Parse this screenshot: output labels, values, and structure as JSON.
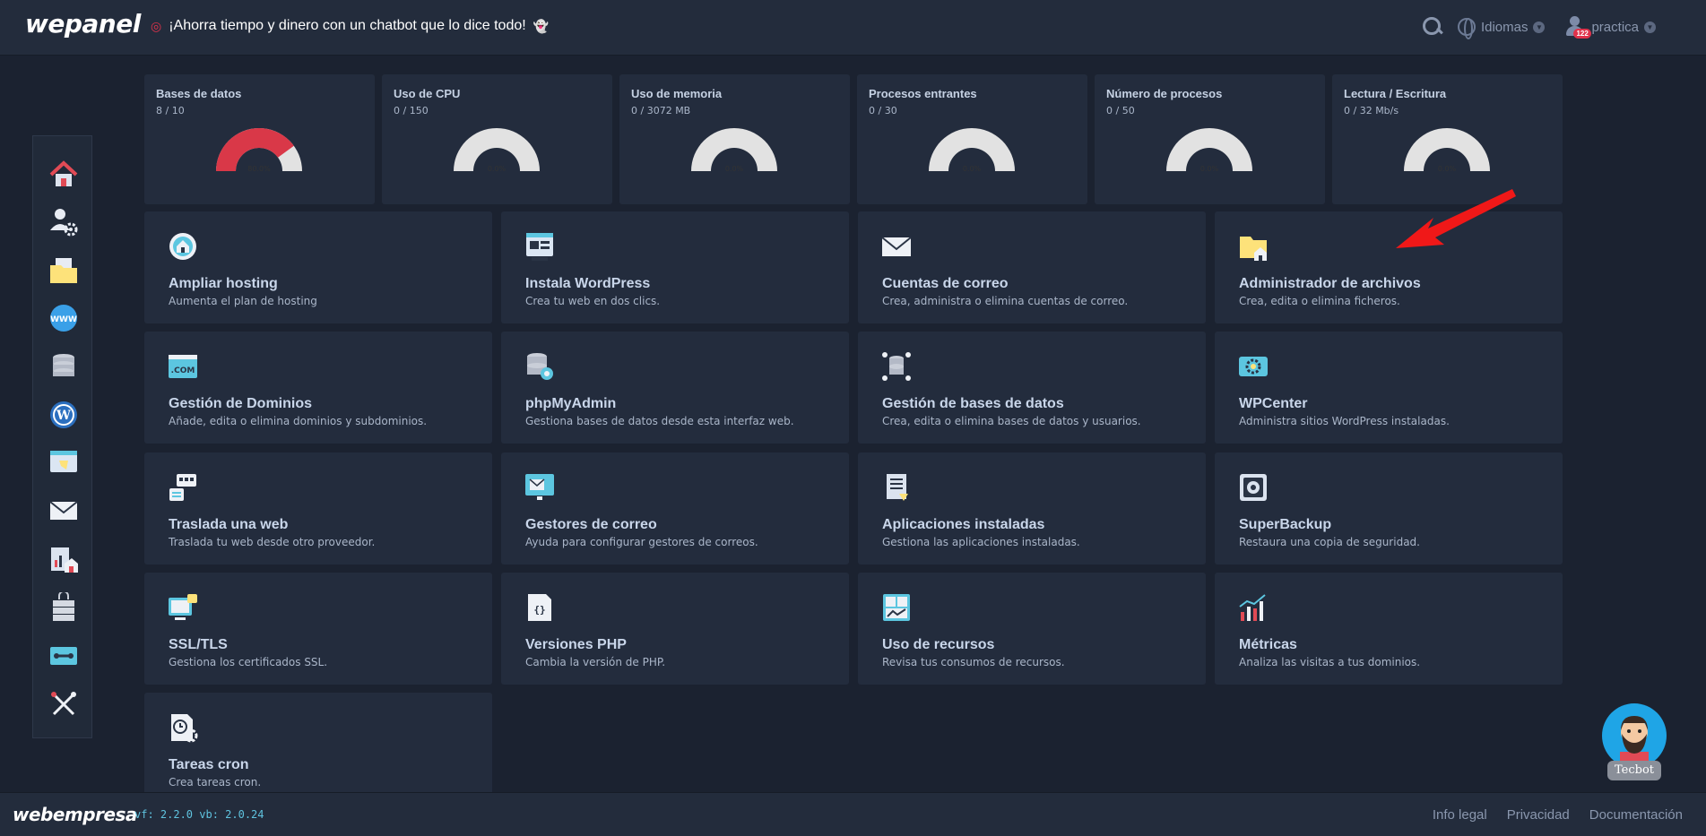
{
  "header": {
    "logo": "wepanel",
    "promo": "¡Ahorra tiempo y dinero con un chatbot que lo dice todo!",
    "languages_label": "Idiomas",
    "user_label": "practica",
    "notification_count": "122"
  },
  "sidebar": {
    "items": [
      "home-icon",
      "user-settings-icon",
      "folder-icon",
      "www-icon",
      "database-icon",
      "wordpress-icon",
      "web-migration-icon",
      "mail-icon",
      "metrics-icon",
      "server-lock-icon",
      "tools-icon",
      "wrench-screwdriver-icon"
    ]
  },
  "stats": [
    {
      "title": "Bases de datos",
      "value": "8 / 10",
      "percent_label": "80.0%",
      "fraction": 0.8
    },
    {
      "title": "Uso de CPU",
      "value": "0 / 150",
      "percent_label": "0.0%",
      "fraction": 0
    },
    {
      "title": "Uso de memoria",
      "value": "0 / 3072 MB",
      "percent_label": "0.0%",
      "fraction": 0
    },
    {
      "title": "Procesos entrantes",
      "value": "0 / 30",
      "percent_label": "0.0%",
      "fraction": 0
    },
    {
      "title": "Número de procesos",
      "value": "0 / 50",
      "percent_label": "0.0%",
      "fraction": 0
    },
    {
      "title": "Lectura / Escritura",
      "value": "0 / 32 Mb/s",
      "percent_label": "0.0%",
      "fraction": 0
    }
  ],
  "tiles": [
    {
      "name": "Ampliar hosting",
      "desc": "Aumenta el plan de hosting",
      "icon": "upgrade-icon"
    },
    {
      "name": "Instala WordPress",
      "desc": "Crea tu web en dos clics.",
      "icon": "wordpress-install-icon"
    },
    {
      "name": "Cuentas de correo",
      "desc": "Crea, administra o elimina cuentas de correo.",
      "icon": "envelope-icon"
    },
    {
      "name": "Administrador de archivos",
      "desc": "Crea, edita o elimina ficheros.",
      "icon": "file-manager-icon"
    },
    {
      "name": "Gestión de Dominios",
      "desc": "Añade, edita o elimina dominios y subdominios.",
      "icon": "domain-icon"
    },
    {
      "name": "phpMyAdmin",
      "desc": "Gestiona bases de datos desde esta interfaz web.",
      "icon": "phpmyadmin-icon"
    },
    {
      "name": "Gestión de bases de datos",
      "desc": "Crea, edita o elimina bases de datos y usuarios.",
      "icon": "database-manage-icon"
    },
    {
      "name": "WPCenter",
      "desc": "Administra sitios WordPress instaladas.",
      "icon": "wpcenter-icon"
    },
    {
      "name": "Traslada una web",
      "desc": "Traslada tu web desde otro proveedor.",
      "icon": "migrate-icon"
    },
    {
      "name": "Gestores de correo",
      "desc": "Ayuda para configurar gestores de correos.",
      "icon": "mail-client-icon"
    },
    {
      "name": "Aplicaciones instaladas",
      "desc": "Gestiona las aplicaciones instaladas.",
      "icon": "apps-icon"
    },
    {
      "name": "SuperBackup",
      "desc": "Restaura una copia de seguridad.",
      "icon": "backup-safe-icon"
    },
    {
      "name": "SSL/TLS",
      "desc": "Gestiona los certificados SSL.",
      "icon": "ssl-icon"
    },
    {
      "name": "Versiones PHP",
      "desc": "Cambia la versión de PHP.",
      "icon": "php-icon"
    },
    {
      "name": "Uso de recursos",
      "desc": "Revisa tus consumos de recursos.",
      "icon": "resources-icon"
    },
    {
      "name": "Métricas",
      "desc": "Analiza las visitas a tus dominios.",
      "icon": "metrics-chart-icon"
    },
    {
      "name": "Tareas cron",
      "desc": "Crea tareas cron.",
      "icon": "cron-icon"
    }
  ],
  "footer": {
    "logo": "webempresa",
    "version": "vf: 2.2.0 vb: 2.0.24",
    "links": [
      "Info legal",
      "Privacidad",
      "Documentación"
    ]
  },
  "chatbot": {
    "label": "Tecbot"
  },
  "colors": {
    "gauge_used": "#d93848",
    "gauge_empty": "#e2e2e2",
    "accent": "#5fc3df",
    "arrow": "#f01818"
  }
}
